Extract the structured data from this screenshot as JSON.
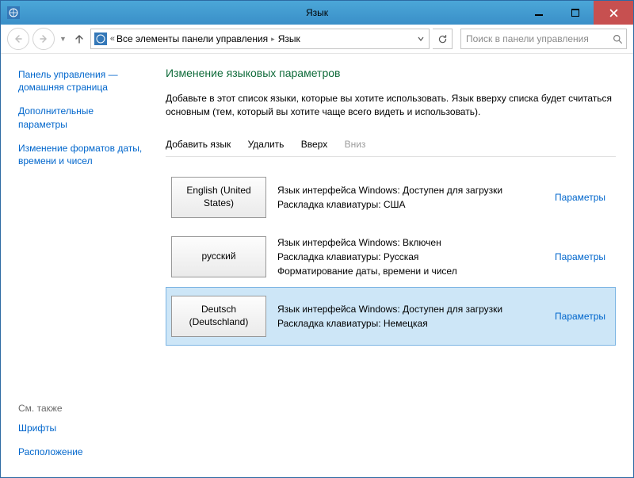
{
  "window": {
    "title": "Язык"
  },
  "breadcrumb": {
    "item1": "Все элементы панели управления",
    "item2": "Язык"
  },
  "search": {
    "placeholder": "Поиск в панели управления"
  },
  "sidebar": {
    "home": "Панель управления — домашняя страница",
    "advanced": "Дополнительные параметры",
    "formats": "Изменение форматов даты, времени и чисел"
  },
  "seealso": {
    "heading": "См. также",
    "fonts": "Шрифты",
    "location": "Расположение"
  },
  "main": {
    "heading": "Изменение языковых параметров",
    "desc": "Добавьте в этот список языки, которые вы хотите использовать. Язык вверху списка будет считаться основным (тем, который вы хотите чаще всего видеть и использовать)."
  },
  "toolbar": {
    "add": "Добавить язык",
    "remove": "Удалить",
    "up": "Вверх",
    "down": "Вниз"
  },
  "options_label": "Параметры",
  "langs": [
    {
      "name": "English (United States)",
      "line1": "Язык интерфейса Windows: Доступен для загрузки",
      "line2": "Раскладка клавиатуры: США",
      "line3": "",
      "selected": false
    },
    {
      "name": "русский",
      "line1": "Язык интерфейса Windows: Включен",
      "line2": "Раскладка клавиатуры: Русская",
      "line3": "Форматирование даты, времени и чисел",
      "selected": false
    },
    {
      "name": "Deutsch (Deutschland)",
      "line1": "Язык интерфейса Windows: Доступен для загрузки",
      "line2": "Раскладка клавиатуры: Немецкая",
      "line3": "",
      "selected": true
    }
  ]
}
